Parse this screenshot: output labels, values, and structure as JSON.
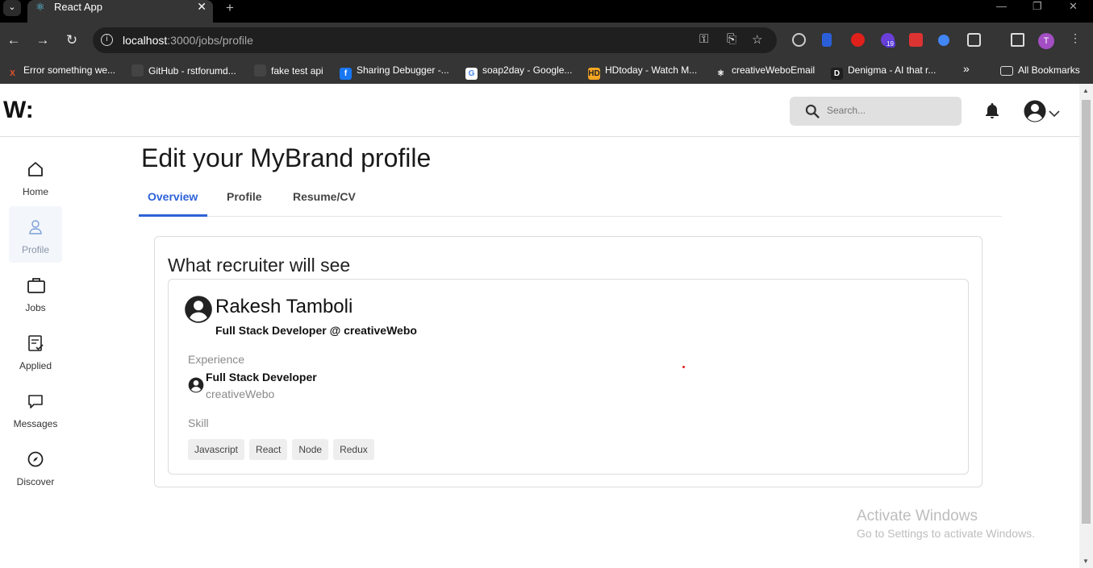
{
  "browser": {
    "tab_title": "React App",
    "url_host": "localhost",
    "url_path": ":3000/jobs/profile",
    "profile_initial": "T",
    "extension_badge": "19",
    "bookmarks": [
      {
        "label": "Error something we...",
        "icon": "X",
        "color": "#e8532b"
      },
      {
        "label": "GitHub - rstforumd...",
        "icon": "",
        "color": "#444"
      },
      {
        "label": "fake test api",
        "icon": "",
        "color": "#444"
      },
      {
        "label": "Sharing Debugger -...",
        "icon": "f",
        "color": "#1877f2"
      },
      {
        "label": "soap2day - Google...",
        "icon": "G",
        "color": "#fff"
      },
      {
        "label": "HDtoday - Watch M...",
        "icon": "HD",
        "color": "#f5a623"
      },
      {
        "label": "creativeWeboEmail",
        "icon": "⚛",
        "color": "#353535"
      },
      {
        "label": "Denigma - AI that r...",
        "icon": "D",
        "color": "#1f1f1f"
      }
    ],
    "all_bookmarks": "All Bookmarks"
  },
  "app": {
    "logo": "W:",
    "search_placeholder": "Search..."
  },
  "sidebar": {
    "items": [
      {
        "label": "Home",
        "icon": "home-icon"
      },
      {
        "label": "Profile",
        "icon": "user-icon"
      },
      {
        "label": "Jobs",
        "icon": "briefcase-icon"
      },
      {
        "label": "Applied",
        "icon": "clipboard-check-icon"
      },
      {
        "label": "Messages",
        "icon": "chat-icon"
      },
      {
        "label": "Discover",
        "icon": "compass-icon"
      }
    ]
  },
  "page": {
    "title": "Edit your MyBrand profile",
    "tabs": [
      "Overview",
      "Profile",
      "Resume/CV"
    ],
    "active_tab": "Overview"
  },
  "preview": {
    "heading": "What recruiter will see",
    "name": "Rakesh Tamboli",
    "headline": "Full Stack Developer @ creativeWebo",
    "experience_label": "Experience",
    "experience": {
      "title": "Full Stack Developer",
      "company": "creativeWebo"
    },
    "skill_label": "Skill",
    "skills": [
      "Javascript",
      "React",
      "Node",
      "Redux"
    ]
  },
  "watermark": {
    "title": "Activate Windows",
    "subtitle": "Go to Settings to activate Windows."
  },
  "colors": {
    "accent": "#2d62d8",
    "chrome_bg": "#353535"
  }
}
